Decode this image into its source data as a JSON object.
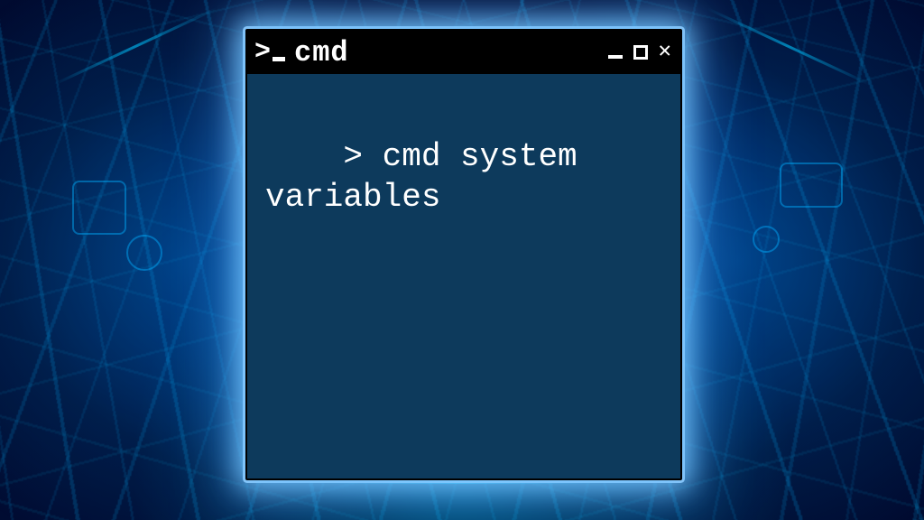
{
  "window": {
    "title": "cmd",
    "prompt_symbol": ">",
    "controls": {
      "minimize": "minimize",
      "maximize": "maximize",
      "close": "✕"
    }
  },
  "terminal": {
    "prompt_char": ">",
    "command_line": "> cmd system variables"
  },
  "colors": {
    "titlebar_bg": "#000000",
    "terminal_bg": "#0d3a5c",
    "text": "#ffffff",
    "glow": "#5ab4ff"
  }
}
